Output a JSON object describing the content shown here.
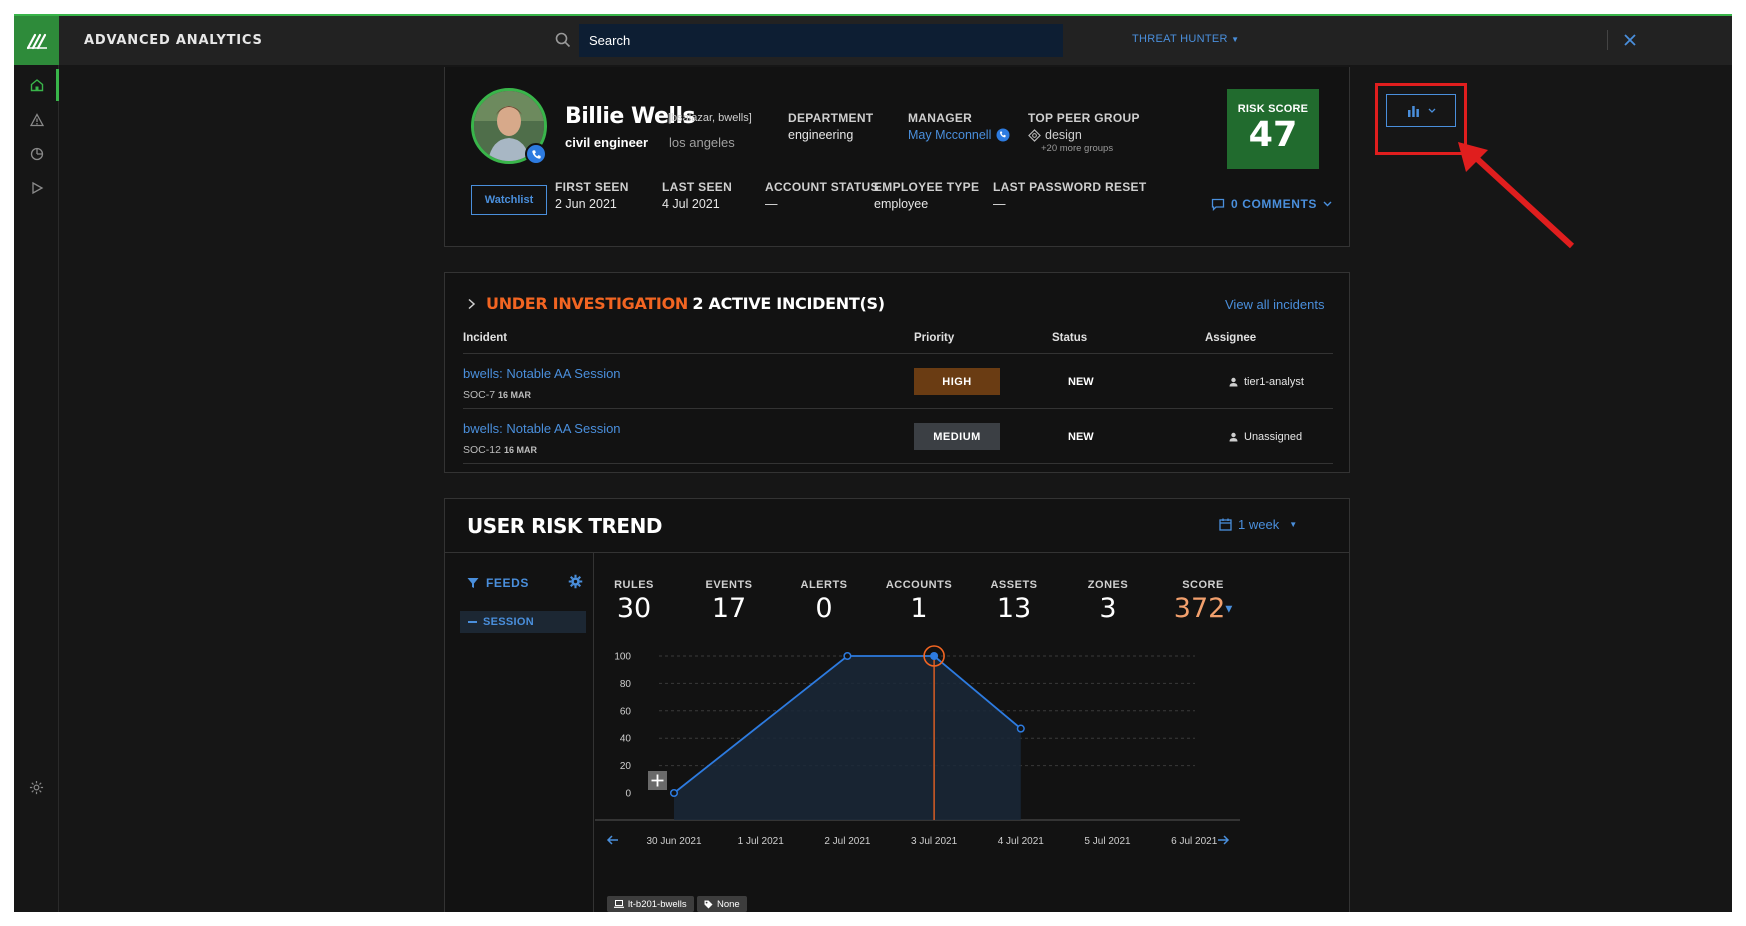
{
  "app": {
    "title": "ADVANCED ANALYTICS",
    "search_placeholder": "Search",
    "role_menu": "THREAT HUNTER",
    "accent_color": "#39b54a",
    "link_color": "#4a8fdc"
  },
  "sidenav": {
    "items": [
      {
        "icon": "home-icon",
        "active": true
      },
      {
        "icon": "warning-icon",
        "active": false
      },
      {
        "icon": "pie-chart-icon",
        "active": false
      },
      {
        "icon": "play-icon",
        "active": false
      }
    ],
    "bottom_icon": "settings-icon"
  },
  "profile": {
    "name": "Billie Wells",
    "aliases": "[bsalazar, bwells]",
    "title": "civil engineer",
    "location": "los angeles",
    "department_label": "DEPARTMENT",
    "department": "engineering",
    "manager_label": "MANAGER",
    "manager": "May Mcconnell",
    "peer_group_label": "TOP PEER GROUP",
    "peer_group": "design",
    "peer_group_more": "+20 more groups",
    "risk_label": "RISK SCORE",
    "risk_score": "47",
    "watchlist_label": "Watchlist",
    "first_seen_label": "FIRST SEEN",
    "first_seen": "2 Jun 2021",
    "last_seen_label": "LAST SEEN",
    "last_seen": "4 Jul 2021",
    "account_status_label": "ACCOUNT STATUS",
    "account_status": "—",
    "employee_type_label": "EMPLOYEE TYPE",
    "employee_type": "employee",
    "last_password_reset_label": "LAST PASSWORD RESET",
    "last_password_reset": "—",
    "comments": "0 COMMENTS"
  },
  "incidents": {
    "status": "UNDER INVESTIGATION",
    "count_text": "2 ACTIVE INCIDENT(S)",
    "view_all": "View all incidents",
    "columns": [
      "Incident",
      "Priority",
      "Status",
      "Assignee"
    ],
    "rows": [
      {
        "name": "bwells: Notable AA Session",
        "id": "SOC-7",
        "date": "16 MAR",
        "priority": "HIGH",
        "status": "NEW",
        "assignee": "tier1-analyst"
      },
      {
        "name": "bwells: Notable AA Session",
        "id": "SOC-12",
        "date": "16 MAR",
        "priority": "MEDIUM",
        "status": "NEW",
        "assignee": "Unassigned"
      }
    ]
  },
  "trend": {
    "title": "USER RISK TREND",
    "period": "1 week",
    "feeds_label": "FEEDS",
    "feed_item": "SESSION",
    "stats": [
      {
        "label": "RULES",
        "value": "30"
      },
      {
        "label": "EVENTS",
        "value": "17"
      },
      {
        "label": "ALERTS",
        "value": "0"
      },
      {
        "label": "ACCOUNTS",
        "value": "1"
      },
      {
        "label": "ASSETS",
        "value": "13"
      },
      {
        "label": "ZONES",
        "value": "3"
      },
      {
        "label": "SCORE",
        "value": "372"
      }
    ],
    "chips": [
      "lt-b201-bwells",
      "None"
    ]
  },
  "chart_data": {
    "type": "area",
    "categories": [
      "30 Jun 2021",
      "1 Jul 2021",
      "2 Jul 2021",
      "3 Jul 2021",
      "4 Jul 2021",
      "5 Jul 2021",
      "6 Jul 2021"
    ],
    "series": [
      {
        "values": [
          0,
          null,
          100,
          100,
          47,
          null,
          null
        ]
      }
    ],
    "y_ticks": [
      "0",
      "20",
      "40",
      "60",
      "80",
      "100"
    ],
    "ylim": [
      0,
      100
    ],
    "highlighted_point": "3 Jul 2021",
    "line_color": "#2d7be0",
    "highlight_color": "#f26522"
  }
}
